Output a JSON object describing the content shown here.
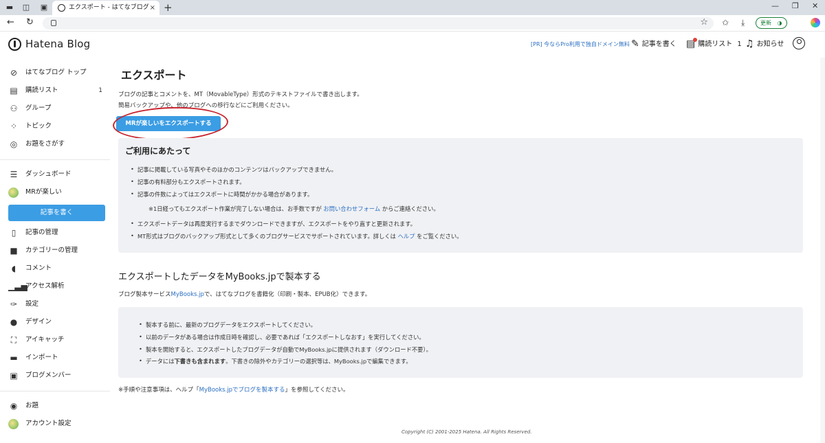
{
  "browser": {
    "tab_title": "エクスポート - はてなブログ",
    "tab_close": "×",
    "new_tab": "+",
    "minimize": "—",
    "maximize": "❐",
    "close": "✕",
    "back": "←",
    "reload": "↻",
    "update_label": "更新",
    "icons": [
      "sidebar-icon",
      "collections-icon",
      "tab-actions-icon",
      "favorite-star-icon",
      "favorites-icon",
      "downloads-icon",
      "update-icon",
      "copilot-icon"
    ]
  },
  "header": {
    "logo_text": "Hatena Blog",
    "promo_link": "[PR] 今ならPro利用で独自ドメイン無料",
    "write_label": "記事を書く",
    "reading_list_label": "購読リスト",
    "reading_list_count": "1",
    "notifications_label": "お知らせ"
  },
  "sidebar": {
    "items_top": [
      {
        "label": "はてなブログ トップ",
        "icon": "hatena-icon"
      },
      {
        "label": "購読リスト",
        "icon": "reading-list-icon",
        "count": "1"
      },
      {
        "label": "グループ",
        "icon": "group-icon"
      },
      {
        "label": "トピック",
        "icon": "topic-icon"
      },
      {
        "label": "お題をさがす",
        "icon": "search-topic-icon"
      }
    ],
    "items_blog": [
      {
        "label": "ダッシュボード",
        "icon": "dashboard-icon"
      },
      {
        "label": "MRが楽しい",
        "icon": "blog-avatar"
      }
    ],
    "write_button": "記事を書く",
    "items_manage": [
      {
        "label": "記事の管理",
        "icon": "document-icon"
      },
      {
        "label": "カテゴリーの管理",
        "icon": "folder-icon"
      },
      {
        "label": "コメント",
        "icon": "comment-icon"
      },
      {
        "label": "アクセス解析",
        "icon": "analytics-icon"
      },
      {
        "label": "設定",
        "icon": "wrench-icon"
      },
      {
        "label": "デザイン",
        "icon": "palette-icon"
      },
      {
        "label": "アイキャッチ",
        "icon": "eyecatch-icon"
      },
      {
        "label": "インポート",
        "icon": "truck-icon"
      },
      {
        "label": "ブログメンバー",
        "icon": "members-icon"
      }
    ],
    "items_bottom": [
      {
        "label": "お題",
        "icon": "odai-icon"
      },
      {
        "label": "アカウント設定",
        "icon": "account-avatar"
      }
    ]
  },
  "main": {
    "title": "エクスポート",
    "desc1": "ブログの記事とコメントを、MT（MovableType）形式のテキストファイルで書き出します。",
    "desc2": "簡易バックアップや、他のブログへの移行などにご利用ください。",
    "export_button": "MRが楽しいをエクスポートする",
    "notes_title": "ご利用にあたって",
    "notes": [
      "記事に掲載している写真やそのほかのコンテンツはバックアップできません。",
      "記事の有料部分もエクスポートされます。",
      "記事の件数によってはエクスポートに時間がかかる場合があります。"
    ],
    "note_sub_pre": "※1日経ってもエクスポート作業が完了しない場合は、お手数ですが ",
    "note_sub_link": "お問い合わせフォーム",
    "note_sub_post": " からご連絡ください。",
    "note4": "エクスポートデータは再度実行するまでダウンロードできますが、エクスポートをやり直すと更新されます。",
    "note5_pre": "MT形式はブログのバックアップ形式として多くのブログサービスでサポートされています。詳しくは ",
    "note5_link": "ヘルプ",
    "note5_post": " をご覧ください。",
    "mybooks_title": "エクスポートしたデータをMyBooks.jpで製本する",
    "mybooks_desc_pre": "ブログ製本サービス",
    "mybooks_desc_link": "MyBooks.jp",
    "mybooks_desc_post": "で、はてなブログを書籍化（印刷・製本、EPUB化）できます。",
    "mybooks_notes": [
      "製本する前に、最新のブログデータをエクスポートしてください。",
      "以前のデータがある場合は作成日時を確認し、必要であれば「エクスポートしなおす」を実行してください。",
      "製本を開始すると、エクスポートしたブログデータが自動でMyBooks.jpに提供されます（ダウンロード不要）。"
    ],
    "mybooks_note4_pre": "データには",
    "mybooks_note4_bold": "下書きも含まれます",
    "mybooks_note4_post": "。下書きの除外やカテゴリーの選択等は、MyBooks.jpで編集できます。",
    "footnote_pre": "※手順や注意事項は、ヘルプ「",
    "footnote_link": "MyBooks.jpでブログを製本する",
    "footnote_post": "」を参照してください。",
    "copyright": "Copyright (C) 2001-2025 Hatena. All Rights Reserved."
  }
}
